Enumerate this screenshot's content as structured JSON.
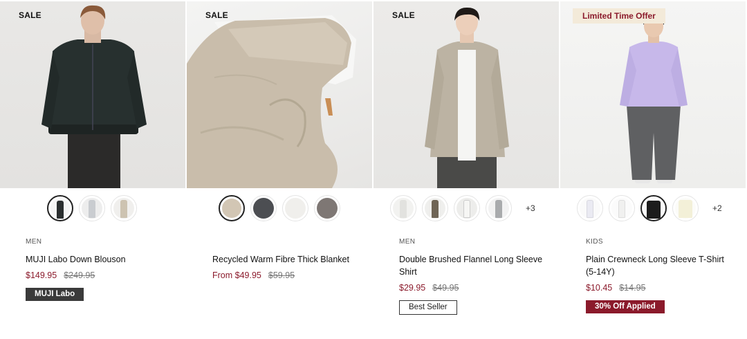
{
  "products": [
    {
      "tag": "SALE",
      "image_icon": "man-bomber-jacket-photo",
      "swatches": [
        "#2a2e2f",
        "#c9ccd0",
        "#cdc3b1"
      ],
      "more": "",
      "category": "MEN",
      "name": "MUJI Labo Down Blouson",
      "price": "$149.95",
      "was": "$249.95",
      "badge": "MUJI Labo"
    },
    {
      "tag": "SALE",
      "image_icon": "blanket-on-bed-photo",
      "swatches": [
        "#d2c6b4",
        "#4c4e52",
        "#f0efec",
        "#7e7774"
      ],
      "more": "",
      "category": "",
      "name": "Recycled Warm Fibre Thick Blanket",
      "price": "From $49.95",
      "was": "$59.95",
      "badge": ""
    },
    {
      "tag": "SALE",
      "image_icon": "man-flannel-shirt-photo",
      "swatches": [
        "#f2f2f0",
        "#6f6556",
        "#f6f6f4",
        "#a9abad"
      ],
      "more": "+3",
      "category": "MEN",
      "name": "Double Brushed Flannel Long Sleeve Shirt",
      "price": "$29.95",
      "was": "$49.95",
      "badge": "Best Seller"
    },
    {
      "tag": "Limited Time Offer",
      "image_icon": "child-lavender-tshirt-photo",
      "swatches": [
        "#f4f4f7",
        "#f7f7f6",
        "#1c1c1c",
        "#f3f0d8"
      ],
      "more": "+2",
      "category": "KIDS",
      "name": "Plain Crewneck Long Sleeve T-Shirt (5-14Y)",
      "price": "$10.45",
      "was": "$14.95",
      "badge": "30% Off Applied"
    }
  ],
  "colors": {
    "sale_price": "#8b1a2b",
    "offer_bg": "#f3ead9"
  }
}
